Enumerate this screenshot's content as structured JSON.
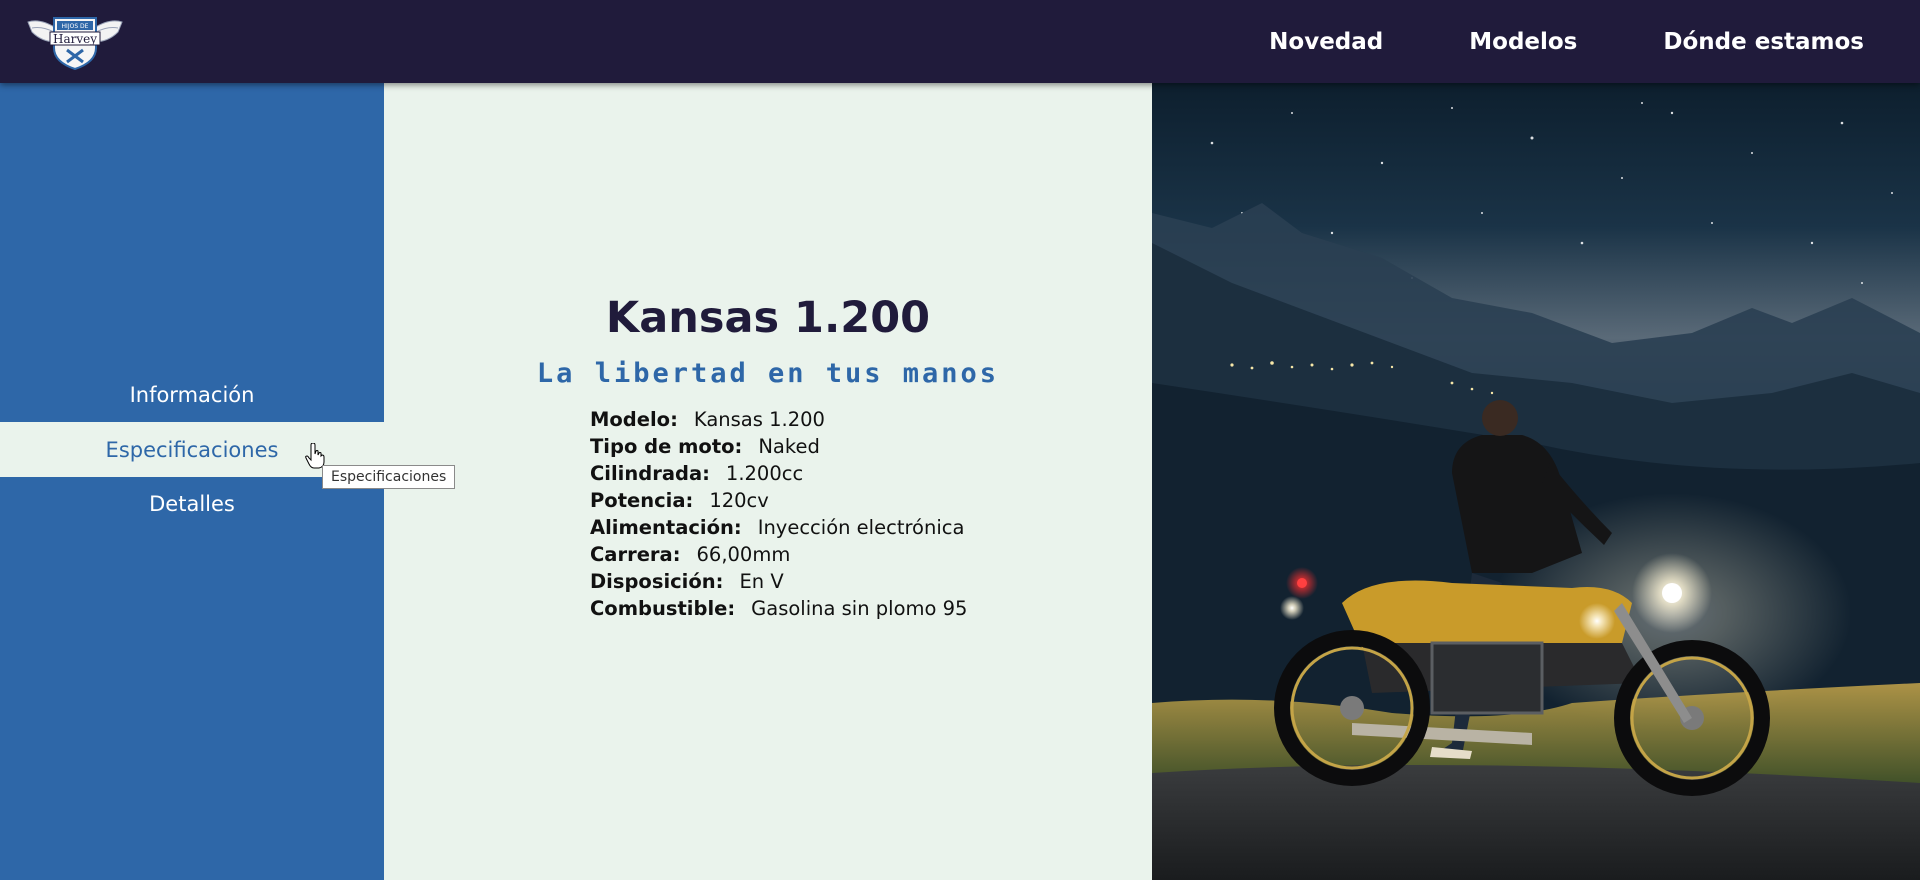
{
  "header": {
    "logo_top": "HIJOS DE",
    "logo_name": "Harvey",
    "nav": [
      {
        "label": "Novedad"
      },
      {
        "label": "Modelos"
      },
      {
        "label": "Dónde estamos"
      }
    ]
  },
  "sidebar": {
    "items": [
      {
        "label": "Información",
        "active": false
      },
      {
        "label": "Especificaciones",
        "active": true
      },
      {
        "label": "Detalles",
        "active": false
      }
    ],
    "tooltip": "Especificaciones"
  },
  "product": {
    "title": "Kansas 1.200",
    "subtitle": "La libertad en tus manos",
    "specs": [
      {
        "label": "Modelo:",
        "value": "Kansas 1.200"
      },
      {
        "label": "Tipo de moto:",
        "value": "Naked"
      },
      {
        "label": "Cilindrada:",
        "value": "1.200cc"
      },
      {
        "label": "Potencia:",
        "value": "120cv"
      },
      {
        "label": "Alimentación:",
        "value": "Inyección electrónica"
      },
      {
        "label": "Carrera:",
        "value": "66,00mm"
      },
      {
        "label": "Disposición:",
        "value": "En V"
      },
      {
        "label": "Combustible:",
        "value": "Gasolina sin plomo 95"
      }
    ]
  },
  "colors": {
    "header_bg": "#201b3b",
    "sidebar_bg": "#2e67a8",
    "content_bg": "#eaf3ec",
    "title": "#201b3b",
    "accent": "#2e67a8"
  }
}
